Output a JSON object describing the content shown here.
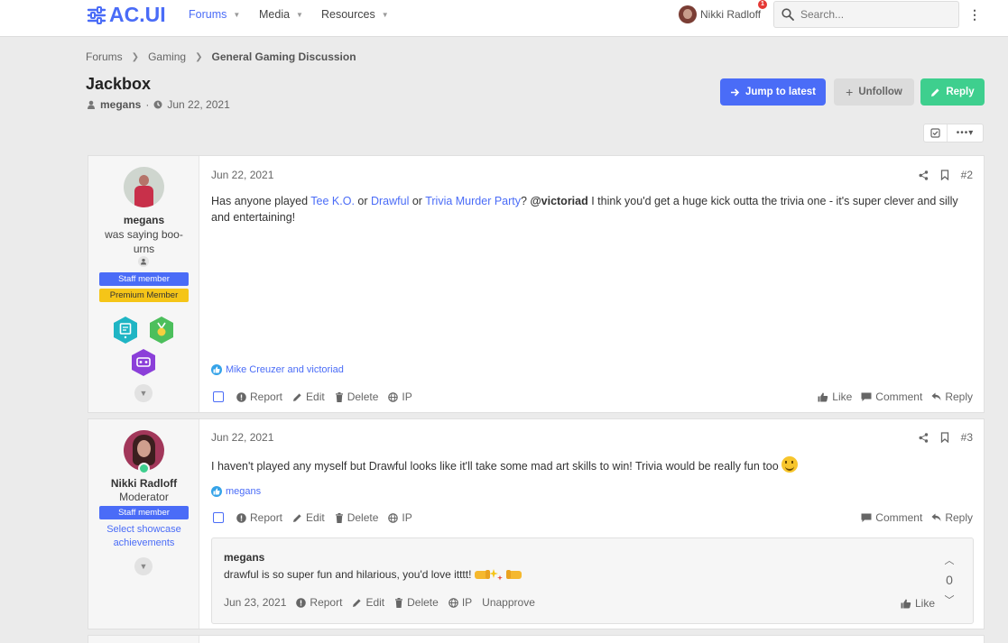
{
  "header": {
    "logo": "AC.UI",
    "nav": [
      {
        "label": "Forums",
        "active": true
      },
      {
        "label": "Media",
        "active": false
      },
      {
        "label": "Resources",
        "active": false
      }
    ],
    "user": {
      "name": "Nikki Radloff",
      "notifications": "1"
    },
    "search_placeholder": "Search..."
  },
  "breadcrumb": [
    "Forums",
    "Gaming",
    "General Gaming Discussion"
  ],
  "thread": {
    "title": "Jackbox",
    "author": "megans",
    "date": "Jun 22, 2021",
    "buttons": {
      "jump": "Jump to latest",
      "unfollow": "Unfollow",
      "reply": "Reply"
    }
  },
  "posts": [
    {
      "user": {
        "name": "megans",
        "title": "was saying boo-urns",
        "banners": [
          "Staff member",
          "Premium Member"
        ]
      },
      "date": "Jun 22, 2021",
      "number": "#2",
      "body": {
        "p1": "Has anyone played ",
        "l1": "Tee K.O.",
        "p2": " or ",
        "l2": "Drawful",
        "p3": " or ",
        "l3": "Trivia Murder Party",
        "p4": "? ",
        "mention": "@victoriad",
        "p5": " I think you'd get a huge kick outta the trivia one - it's super clever and silly and entertaining!"
      },
      "reactions": "Mike Creuzer and victoriad",
      "actions": {
        "report": "Report",
        "edit": "Edit",
        "delete": "Delete",
        "ip": "IP",
        "like": "Like",
        "comment": "Comment",
        "reply": "Reply"
      }
    },
    {
      "user": {
        "name": "Nikki Radloff",
        "title": "Moderator",
        "banners": [
          "Staff member"
        ],
        "showcase": "Select showcase achievements"
      },
      "date": "Jun 22, 2021",
      "number": "#3",
      "body": "I haven't played any myself but Drawful looks like it'll take some mad art skills to win! Trivia would be really fun too",
      "reactions": "megans",
      "actions": {
        "report": "Report",
        "edit": "Edit",
        "delete": "Delete",
        "ip": "IP",
        "comment": "Comment",
        "reply": "Reply"
      },
      "comment": {
        "author": "megans",
        "text": "drawful is so super fun and hilarious, you'd love itttt!",
        "date": "Jun 23, 2021",
        "actions": {
          "report": "Report",
          "edit": "Edit",
          "delete": "Delete",
          "ip": "IP",
          "unapprove": "Unapprove",
          "like": "Like"
        },
        "votes": "0"
      }
    }
  ],
  "colors": {
    "accent": "#4a6cf7",
    "reply": "#3ecf8e",
    "premium": "#f5c518",
    "background": "#ebebeb"
  }
}
